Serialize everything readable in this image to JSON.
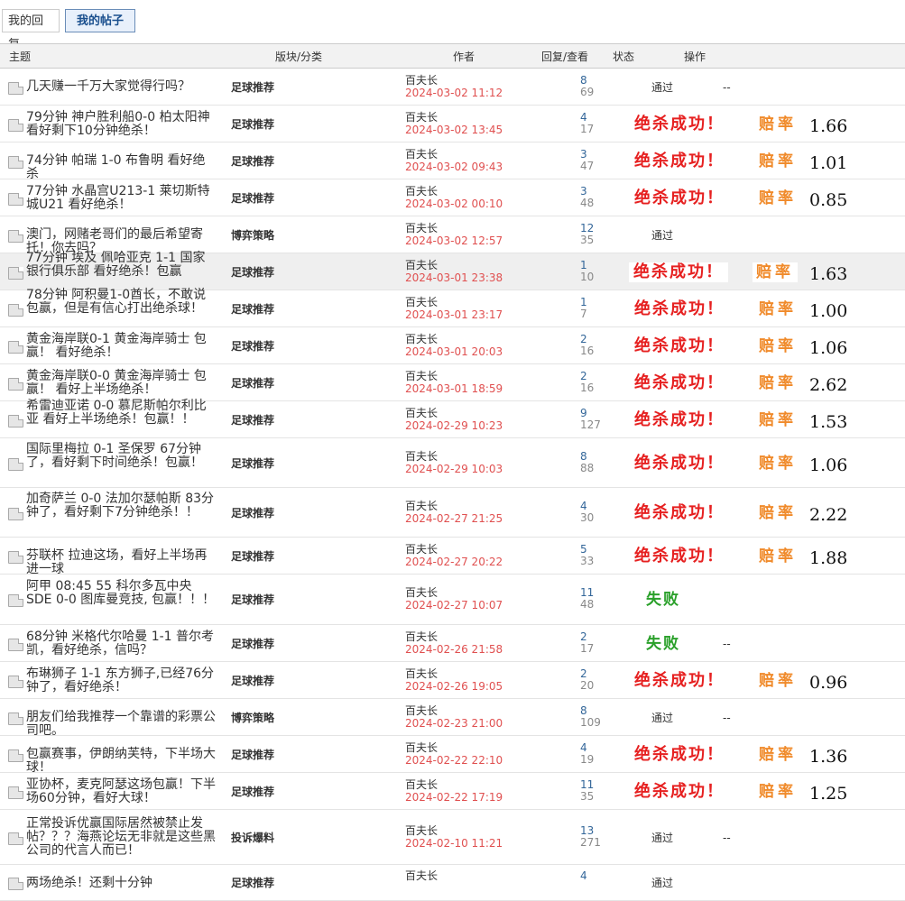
{
  "tabs": [
    {
      "label": "我的回复",
      "active": false
    },
    {
      "label": "我的帖子",
      "active": true
    }
  ],
  "columns": {
    "subject": "主题",
    "forum": "版块/分类",
    "author": "作者",
    "stats": "回复/查看",
    "status": "状态",
    "ops": "操作"
  },
  "colors": {
    "win": "#e62020",
    "lose": "#2aa02a",
    "odds_label": "#f08a2a",
    "date": "#e05050",
    "active_tab": "#1a4f8e"
  },
  "icons": {
    "thread": "document-icon"
  },
  "rows": [
    {
      "title": "几天赚一千万大家觉得行吗？",
      "forum": "足球推荐",
      "author": "百夫长",
      "date": "2024-03-02 11:12",
      "replies": "8",
      "views": "69",
      "status": "通过",
      "ops": "--",
      "badge": "",
      "odds_label": "",
      "odds": ""
    },
    {
      "title": "79分钟 神户胜利船0-0 柏太阳神 看好剩下10分钟绝杀！",
      "forum": "足球推荐",
      "author": "百夫长",
      "date": "2024-03-02 13:45",
      "replies": "4",
      "views": "17",
      "status": "",
      "ops": "",
      "badge": "绝杀成功！",
      "odds_label": "赔率",
      "odds": "1.66"
    },
    {
      "title": "74分钟 帕瑞 1-0 布鲁明 看好绝杀",
      "forum": "足球推荐",
      "author": "百夫长",
      "date": "2024-03-02 09:43",
      "replies": "3",
      "views": "47",
      "status": "",
      "ops": "",
      "badge": "绝杀成功！",
      "odds_label": "赔率",
      "odds": "1.01"
    },
    {
      "title": "77分钟 水晶宫U213-1 莱切斯特城U21 看好绝杀！",
      "forum": "足球推荐",
      "author": "百夫长",
      "date": "2024-03-02 00:10",
      "replies": "3",
      "views": "48",
      "status": "",
      "ops": "",
      "badge": "绝杀成功！",
      "odds_label": "赔率",
      "odds": "0.85"
    },
    {
      "title": "澳门，网赌老哥们的最后希望寄托！你去吗？",
      "forum": "博弈策略",
      "author": "百夫长",
      "date": "2024-03-02 12:57",
      "replies": "12",
      "views": "35",
      "status": "通过",
      "ops": "",
      "badge": "",
      "odds_label": "",
      "odds": ""
    },
    {
      "title": "77分钟 埃及 佩哈亚克 1-1 国家银行俱乐部 看好绝杀！包赢",
      "forum": "足球推荐",
      "author": "百夫长",
      "date": "2024-03-01 23:38",
      "replies": "1",
      "views": "10",
      "status": "",
      "ops": "",
      "badge": "绝杀成功！",
      "odds_label": "赔率",
      "odds": "1.63"
    },
    {
      "title": "78分钟 阿积曼1-0酋长，不敢说包赢，但是有信心打出绝杀球！",
      "forum": "足球推荐",
      "author": "百夫长",
      "date": "2024-03-01 23:17",
      "replies": "1",
      "views": "7",
      "status": "",
      "ops": "",
      "badge": "绝杀成功！",
      "odds_label": "赔率",
      "odds": "1.00"
    },
    {
      "title": "黄金海岸联0-1 黄金海岸骑士 包赢！ 看好绝杀！",
      "forum": "足球推荐",
      "author": "百夫长",
      "date": "2024-03-01 20:03",
      "replies": "2",
      "views": "16",
      "status": "",
      "ops": "",
      "badge": "绝杀成功！",
      "odds_label": "赔率",
      "odds": "1.06"
    },
    {
      "title": "黄金海岸联0-0 黄金海岸骑士 包赢！ 看好上半场绝杀！",
      "forum": "足球推荐",
      "author": "百夫长",
      "date": "2024-03-01 18:59",
      "replies": "2",
      "views": "16",
      "status": "",
      "ops": "",
      "badge": "绝杀成功！",
      "odds_label": "赔率",
      "odds": "2.62"
    },
    {
      "title": "希雷迪亚诺 0-0 慕尼斯帕尔利比亚 看好上半场绝杀！包赢！！",
      "forum": "足球推荐",
      "author": "百夫长",
      "date": "2024-02-29 10:23",
      "replies": "9",
      "views": "127",
      "status": "",
      "ops": "",
      "badge": "绝杀成功！",
      "odds_label": "赔率",
      "odds": "1.53"
    },
    {
      "title": "国际里梅拉 0-1 圣保罗 67分钟了，看好剩下时间绝杀！包赢！",
      "forum": "足球推荐",
      "author": "百夫长",
      "date": "2024-02-29 10:03",
      "replies": "8",
      "views": "88",
      "status": "",
      "ops": "",
      "badge": "绝杀成功！",
      "odds_label": "赔率",
      "odds": "1.06"
    },
    {
      "title": "加奇萨兰 0-0 法加尔瑟帕斯 83分钟了，看好剩下7分钟绝杀！！",
      "forum": "足球推荐",
      "author": "百夫长",
      "date": "2024-02-27 21:25",
      "replies": "4",
      "views": "30",
      "status": "",
      "ops": "",
      "badge": "绝杀成功！",
      "odds_label": "赔率",
      "odds": "2.22"
    },
    {
      "title": "芬联杯 拉迪这场，看好上半场再进一球",
      "forum": "足球推荐",
      "author": "百夫长",
      "date": "2024-02-27 20:22",
      "replies": "5",
      "views": "33",
      "status": "",
      "ops": "",
      "badge": "绝杀成功！",
      "odds_label": "赔率",
      "odds": "1.88"
    },
    {
      "title": "阿甲 08:45 55 科尔多瓦中央SDE 0-0 图库曼竞技, 包赢！！！",
      "forum": "足球推荐",
      "author": "百夫长",
      "date": "2024-02-27 10:07",
      "replies": "11",
      "views": "48",
      "status": "",
      "ops": "",
      "badge": "失败",
      "odds_label": "",
      "odds": ""
    },
    {
      "title": "68分钟 米格代尔哈曼 1-1 普尔考凯，看好绝杀，信吗？",
      "forum": "足球推荐",
      "author": "百夫长",
      "date": "2024-02-26 21:58",
      "replies": "2",
      "views": "17",
      "status": "",
      "ops": "--",
      "badge": "失败",
      "odds_label": "",
      "odds": ""
    },
    {
      "title": "布琳狮子 1-1 东方狮子,已经76分钟了，看好绝杀！",
      "forum": "足球推荐",
      "author": "百夫长",
      "date": "2024-02-26 19:05",
      "replies": "2",
      "views": "20",
      "status": "",
      "ops": "",
      "badge": "绝杀成功！",
      "odds_label": "赔率",
      "odds": "0.96"
    },
    {
      "title": "朋友们给我推荐一个靠谱的彩票公司吧。",
      "forum": "博弈策略",
      "author": "百夫长",
      "date": "2024-02-23 21:00",
      "replies": "8",
      "views": "109",
      "status": "通过",
      "ops": "--",
      "badge": "",
      "odds_label": "",
      "odds": ""
    },
    {
      "title": "包赢赛事，伊朗纳芙特，下半场大球！",
      "forum": "足球推荐",
      "author": "百夫长",
      "date": "2024-02-22 22:10",
      "replies": "4",
      "views": "19",
      "status": "",
      "ops": "",
      "badge": "绝杀成功！",
      "odds_label": "赔率",
      "odds": "1.36"
    },
    {
      "title": "亚协杯，麦克阿瑟这场包赢！下半场60分钟，看好大球！",
      "forum": "足球推荐",
      "author": "百夫长",
      "date": "2024-02-22 17:19",
      "replies": "11",
      "views": "35",
      "status": "",
      "ops": "",
      "badge": "绝杀成功！",
      "odds_label": "赔率",
      "odds": "1.25"
    },
    {
      "title": "正常投诉优赢国际居然被禁止发帖？？？海燕论坛无非就是这些黑公司的代言人而已！",
      "forum": "投诉爆料",
      "author": "百夫长",
      "date": "2024-02-10 11:21",
      "replies": "13",
      "views": "271",
      "status": "通过",
      "ops": "--",
      "badge": "",
      "odds_label": "",
      "odds": ""
    },
    {
      "title": "两场绝杀！还剩十分钟",
      "forum": "足球推荐",
      "author": "百夫长",
      "date": "",
      "replies": "4",
      "views": "",
      "status": "通过",
      "ops": "",
      "badge": "",
      "odds_label": "",
      "odds": ""
    }
  ]
}
